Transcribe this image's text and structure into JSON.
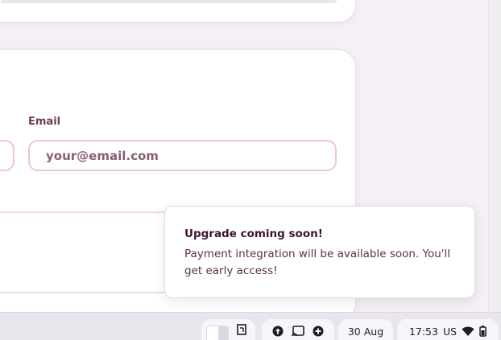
{
  "form": {
    "email_label": "Email",
    "email_placeholder": "your@email.com"
  },
  "toast": {
    "title": "Upgrade coming soon!",
    "message": "Payment integration will be available soon. You'll get early access!"
  },
  "taskbar": {
    "date": "30 Aug",
    "time": "17:53",
    "locale": "US",
    "icons": [
      "cloud-up-icon",
      "cast-icon",
      "add-circle-icon",
      "wifi-icon",
      "battery-icon"
    ]
  },
  "colors": {
    "accent_border": "#ecc4d6",
    "label": "#6b3d58",
    "toast_title": "#3d1531"
  }
}
